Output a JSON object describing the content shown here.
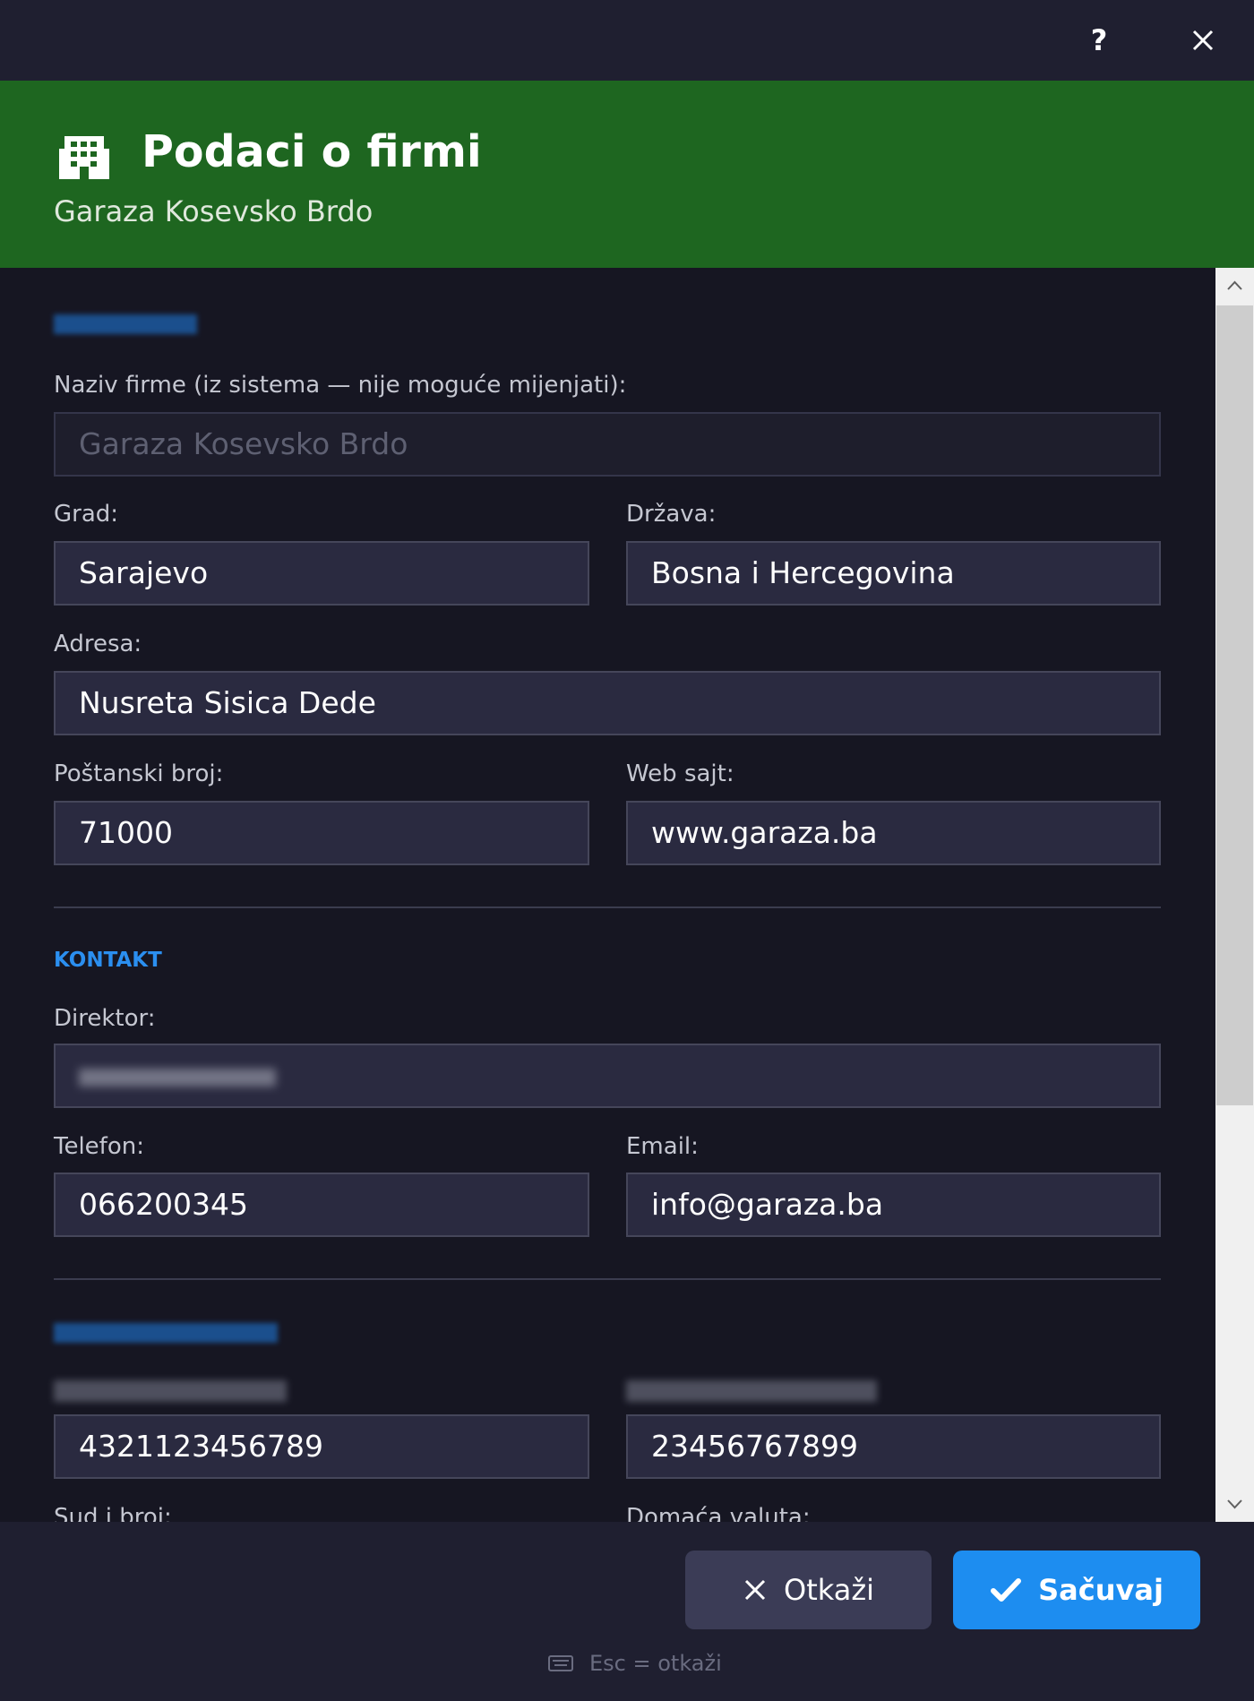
{
  "titlebar": {
    "help_label": "?"
  },
  "header": {
    "title": "Podaci o firmi",
    "subtitle": "Garaza Kosevsko Brdo"
  },
  "form": {
    "naziv_label": "Naziv firme (iz sistema — nije moguće mijenjati):",
    "naziv_value": "Garaza Kosevsko Brdo",
    "grad_label": "Grad:",
    "grad_value": "Sarajevo",
    "drzava_label": "Država:",
    "drzava_value": "Bosna i Hercegovina",
    "adresa_label": "Adresa:",
    "adresa_value": "Nusreta Sisica Dede",
    "postanski_label": "Poštanski broj:",
    "postanski_value": "71000",
    "web_label": "Web sajt:",
    "web_value": "www.garaza.ba",
    "kontakt_title": "KONTAKT",
    "direktor_label": "Direktor:",
    "telefon_label": "Telefon:",
    "telefon_value": "066200345",
    "email_label": "Email:",
    "email_value": "info@garaza.ba",
    "field_a_value": "4321123456789",
    "field_b_value": "23456767899",
    "sud_label": "Sud i broj:",
    "valuta_label": "Domaća valuta:"
  },
  "footer": {
    "cancel_label": "Otkaži",
    "save_label": "Sačuvaj",
    "hint": "Esc = otkaži"
  },
  "colors": {
    "header_bg": "#1e6620",
    "save_button": "#1d8df0",
    "section_title": "#2b8ff0"
  }
}
